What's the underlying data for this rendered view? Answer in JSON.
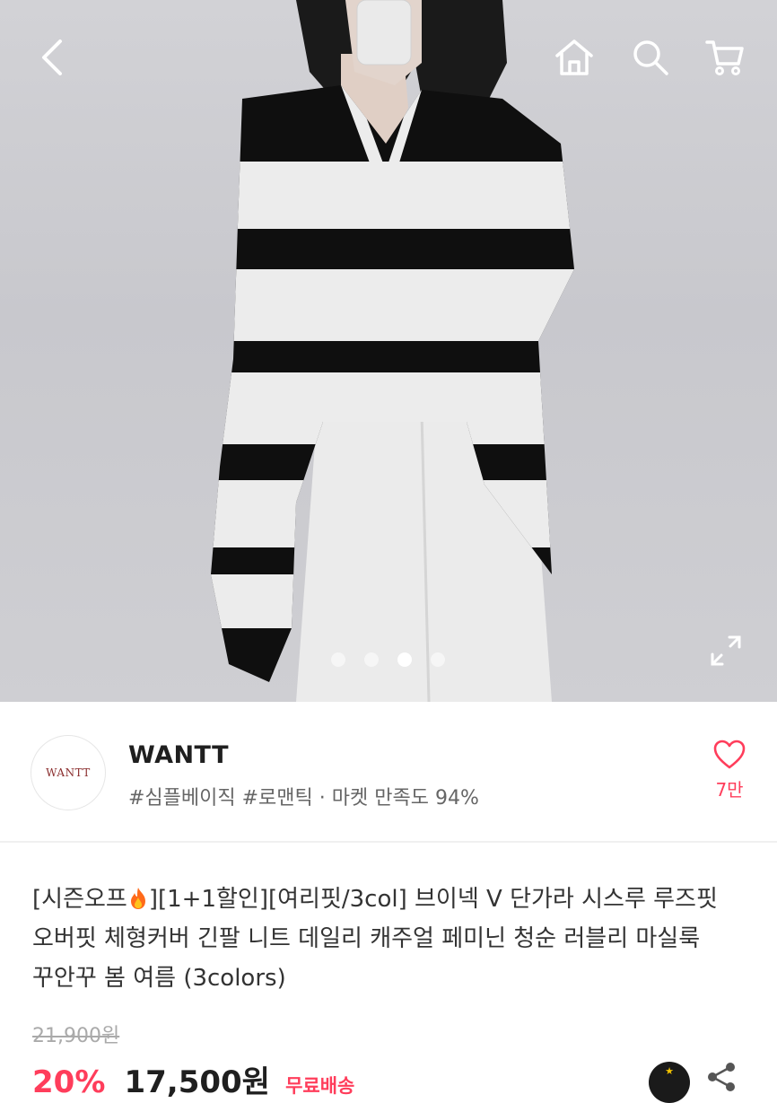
{
  "header": {
    "back_icon": "chevron-left-icon",
    "home_icon": "home-icon",
    "search_icon": "search-icon",
    "cart_icon": "cart-icon"
  },
  "gallery": {
    "slide_count": 4,
    "active_index": 2,
    "expand_icon": "expand-icon"
  },
  "shop": {
    "logo_text": "WANTT",
    "name": "WANTT",
    "tags": "#심플베이직 #로맨틱 · 마켓 만족도 94%",
    "like_icon": "heart-icon",
    "like_count": "7만"
  },
  "product": {
    "title_part1": "[시즌오프",
    "title_part2": "][1+1할인][여리핏/3col] 브이넥 V 단가라 시스루 루즈핏 오버핏 체형커버 긴팔 니트 데일리 캐주얼 페미닌 청순 러블리 마실룩 꾸안꾸 봄 여름 (3colors)",
    "original_price": "21,900원",
    "discount": "20%",
    "price": "17,500원",
    "shipping": "무료배송"
  },
  "colors": {
    "accent": "#ff3d5b",
    "text": "#222222",
    "muted": "#aaaaaa"
  }
}
